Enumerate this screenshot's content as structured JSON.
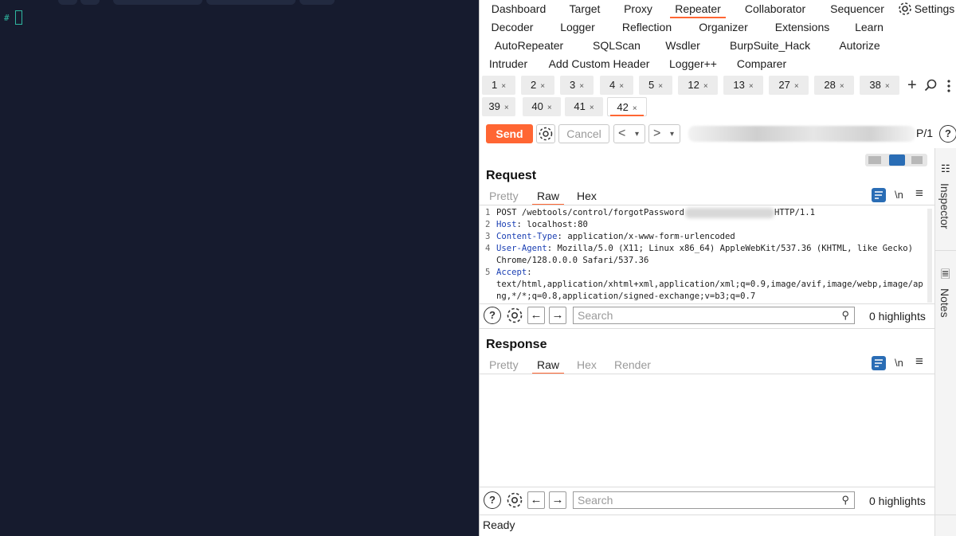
{
  "terminal": {
    "prompt": "#"
  },
  "burp": {
    "main_tabs": [
      "Dashboard",
      "Target",
      "Proxy",
      "Repeater",
      "Collaborator",
      "Sequencer",
      "Decoder",
      "Logger",
      "Reflection",
      "Organizer",
      "Extensions",
      "Learn",
      "AutoRepeater",
      "SQLScan",
      "Wsdler",
      "BurpSuite_Hack",
      "Autorize",
      "Intruder",
      "Add Custom Header",
      "Logger++",
      "Comparer"
    ],
    "settings_label": "Settings",
    "active_main_tab": "Repeater",
    "repeater_tabs": [
      "1",
      "2",
      "3",
      "4",
      "5",
      "12",
      "13",
      "27",
      "28",
      "38",
      "39",
      "40",
      "41",
      "42"
    ],
    "active_repeater_tab": "42",
    "tab_close": "×",
    "add_tab": "+",
    "toolbar": {
      "send": "Send",
      "cancel": "Cancel",
      "back": "<",
      "forward": ">",
      "dropdown": "▾",
      "target_suffix": "P/1",
      "help": "?"
    },
    "request": {
      "title": "Request",
      "tabs": [
        "Pretty",
        "Raw",
        "Hex"
      ],
      "active_tab": "Raw",
      "newline_toggle": "\\n",
      "lines": [
        {
          "num": "1",
          "text": "POST /webtools/control/forgotPassword",
          "tail": "HTTP/1.1"
        },
        {
          "num": "2",
          "key": "Host",
          "value": " localhost:80"
        },
        {
          "num": "3",
          "key": "Content-Type",
          "value": " application/x-www-form-urlencoded"
        },
        {
          "num": "4",
          "key": "User-Agent",
          "value": " Mozilla/5.0 (X11; Linux x86_64) AppleWebKit/537.36 (KHTML, like Gecko)"
        },
        {
          "num": "",
          "text": "Chrome/128.0.0.0 Safari/537.36"
        },
        {
          "num": "5",
          "key": "Accept",
          "value": ""
        },
        {
          "num": "",
          "text": "text/html,application/xhtml+xml,application/xml;q=0.9,image/avif,image/webp,image/ap"
        },
        {
          "num": "",
          "text": "ng,*/*;q=0.8,application/signed-exchange;v=b3;q=0.7"
        }
      ],
      "search_placeholder": "Search",
      "highlights": "0 highlights"
    },
    "response": {
      "title": "Response",
      "tabs": [
        "Pretty",
        "Raw",
        "Hex",
        "Render"
      ],
      "active_tab": "Raw",
      "newline_toggle": "\\n",
      "search_placeholder": "Search",
      "highlights": "0 highlights"
    },
    "rail": {
      "inspector": "Inspector",
      "notes": "Notes"
    },
    "status": "Ready",
    "colors": {
      "accent": "#ff6633",
      "header_key": "#1a3fb3",
      "terminal_bg": "#161b2e",
      "terminal_fg": "#2fb7a0"
    }
  }
}
